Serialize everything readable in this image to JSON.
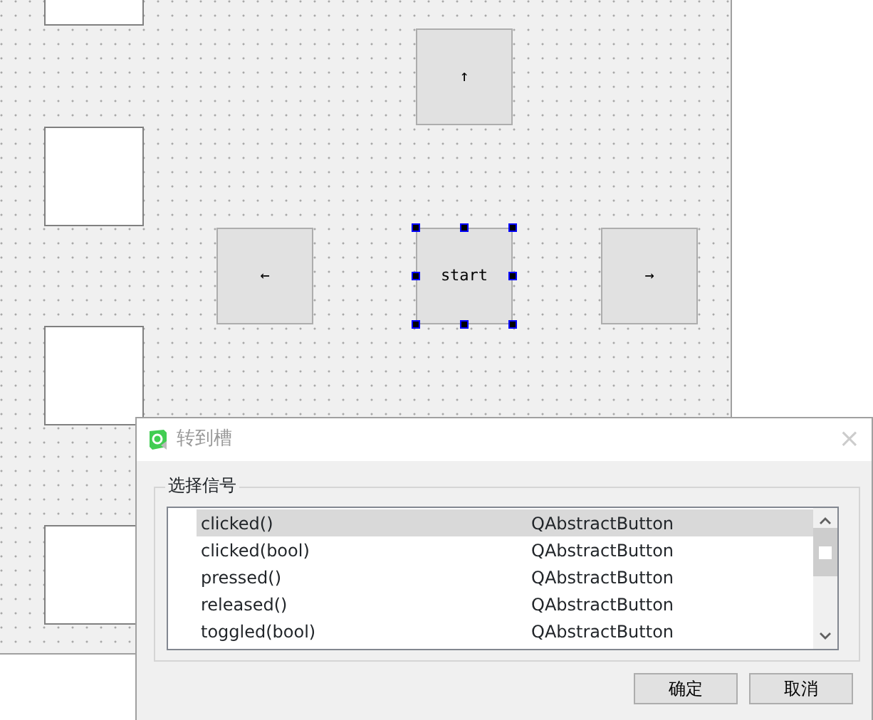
{
  "form": {
    "buttons": [
      {
        "label": "↑",
        "selected": false
      },
      {
        "label": "←",
        "selected": false
      },
      {
        "label": "start",
        "selected": true
      },
      {
        "label": "→",
        "selected": false
      }
    ]
  },
  "dialog": {
    "title": "转到槽",
    "close": "×",
    "group_label": "选择信号",
    "signals": [
      {
        "name": "clicked()",
        "class": "QAbstractButton",
        "selected": true
      },
      {
        "name": "clicked(bool)",
        "class": "QAbstractButton",
        "selected": false
      },
      {
        "name": "pressed()",
        "class": "QAbstractButton",
        "selected": false
      },
      {
        "name": "released()",
        "class": "QAbstractButton",
        "selected": false
      },
      {
        "name": "toggled(bool)",
        "class": "QAbstractButton",
        "selected": false
      }
    ],
    "buttons": [
      "确定",
      "取消"
    ]
  }
}
